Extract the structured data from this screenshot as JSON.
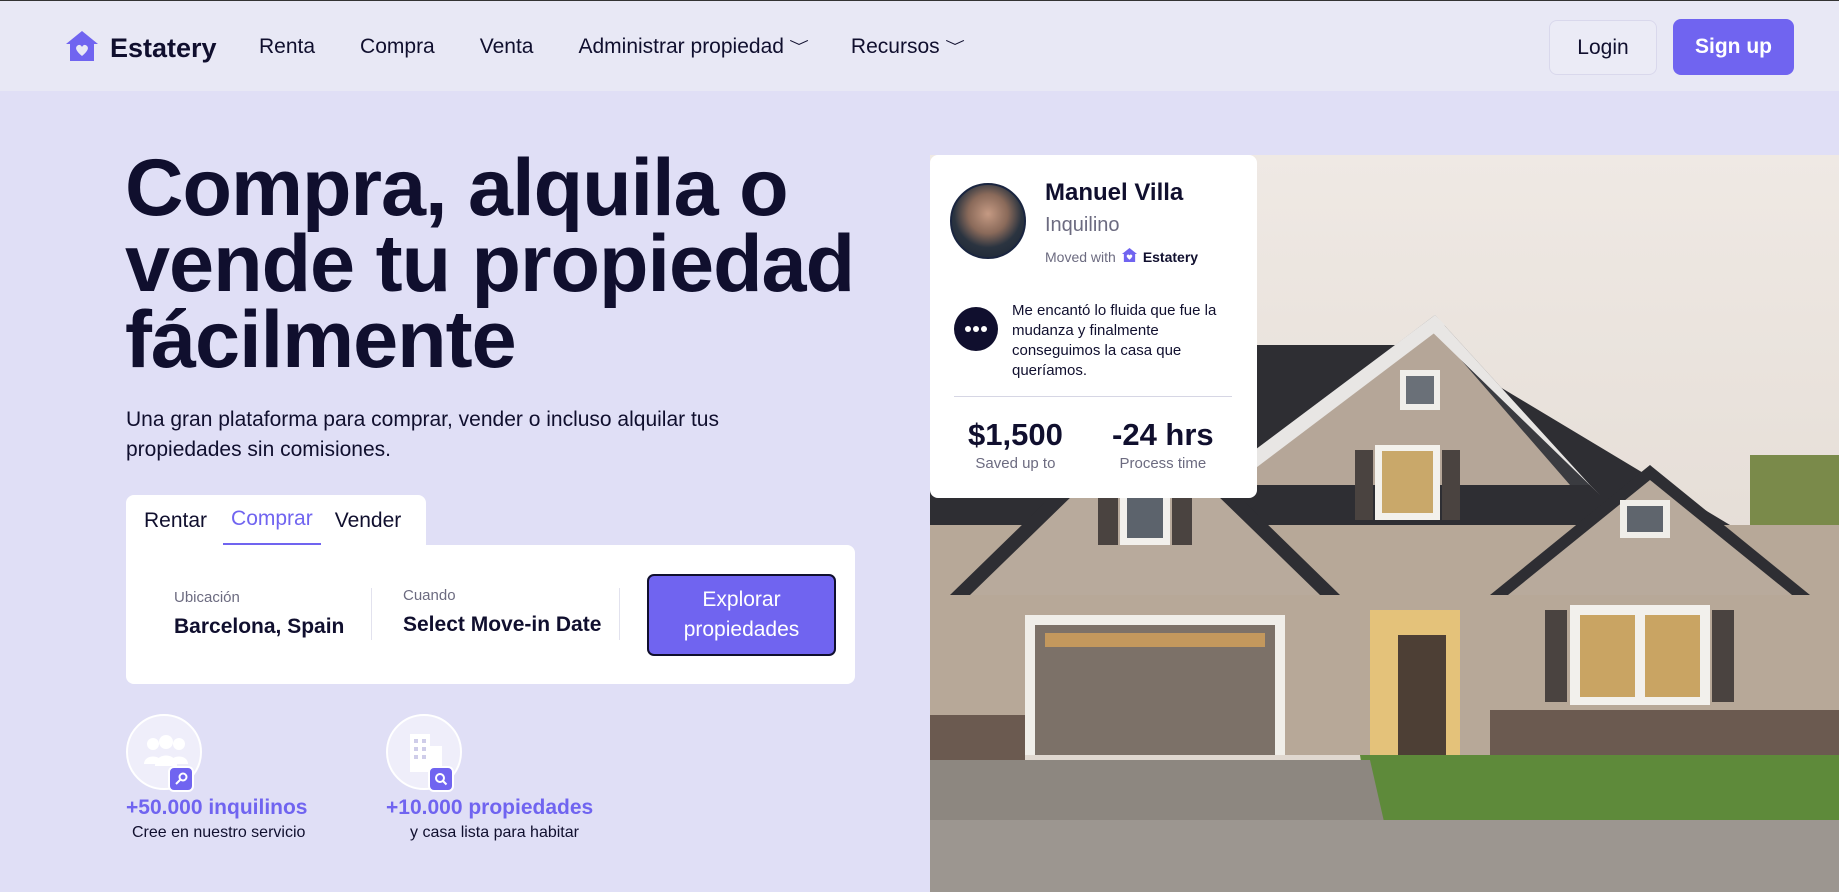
{
  "brand": {
    "name": "Estatery",
    "accent": "#7064f0",
    "icon": "house-heart-icon"
  },
  "nav": {
    "links": [
      "Renta",
      "Compra",
      "Venta",
      "Administrar propiedad",
      "Recursos"
    ],
    "login": "Login",
    "signup": "Sign up"
  },
  "hero": {
    "title": "Compra, alquila o vende tu propiedad fácilmente",
    "subtitle": "Una gran plataforma para comprar, vender o incluso alquilar tus propiedades sin comisiones."
  },
  "search": {
    "tabs": [
      "Rentar",
      "Comprar",
      "Vender"
    ],
    "active_tab": "Comprar",
    "location_label": "Ubicación",
    "location_value": "Barcelona, Spain",
    "when_label": "Cuando",
    "when_value": "Select Move-in Date",
    "button": "Explorar propiedades"
  },
  "stats": [
    {
      "title": "+50.000 inquilinos",
      "subtitle": "Cree en nuestro servicio",
      "icon": "people-key-icon"
    },
    {
      "title": "+10.000 propiedades",
      "subtitle": "y casa lista para habitar",
      "icon": "building-search-icon"
    }
  ],
  "testimonial": {
    "name": "Manuel Villa",
    "role": "Inquilino",
    "moved_with": "Moved with",
    "moved_brand": "Estatery",
    "quote": "Me encantó lo fluida que fue la mudanza y finalmente conseguimos la casa que queríamos.",
    "stat1_value": "$1,500",
    "stat1_label": "Saved up to",
    "stat2_value": "-24 hrs",
    "stat2_label": "Process time"
  }
}
